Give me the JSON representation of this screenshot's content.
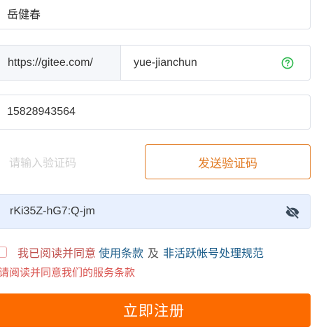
{
  "form": {
    "name_value": "岳健春",
    "gitee_prefix": "https://gitee.com/",
    "gitee_value": "yue-jianchun",
    "phone_value": "15828943564",
    "captcha_placeholder": "请输入验证码",
    "send_code_label": "发送验证码",
    "password_value": "rKi35Z-hG7:Q-jm",
    "agree_text": "我已阅读并同意",
    "terms_link": "使用条款",
    "and_text": "及",
    "policy_link": "非活跃帐号处理规范",
    "agree_error": "请阅读并同意我们的服务条款",
    "register_label": "立即注册"
  },
  "colors": {
    "accent": "#fc6b00",
    "send_code_border": "#e27c25",
    "help_icon": "#2db84d",
    "error_text": "#d9534f",
    "link": "#1f5f8b",
    "password_bg": "#e8f0fe"
  },
  "icons": {
    "help": "question-circle-icon",
    "password_toggle": "eye-slash-icon"
  }
}
